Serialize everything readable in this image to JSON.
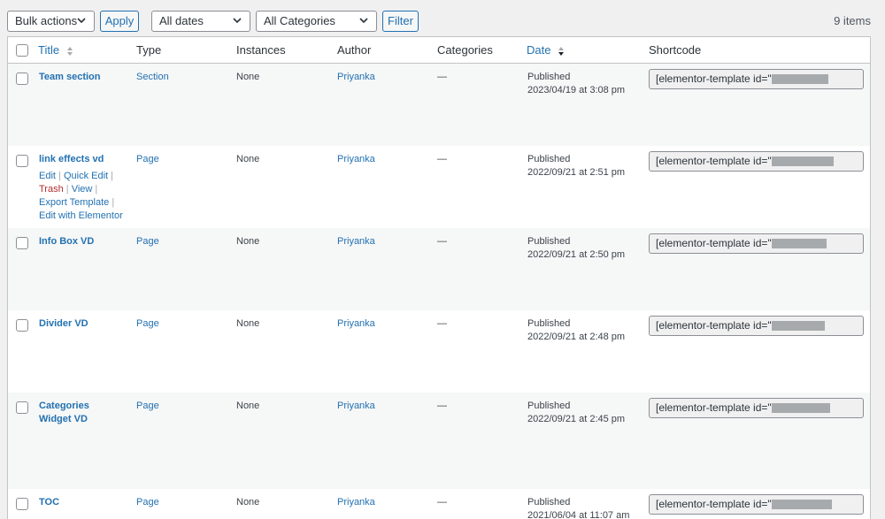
{
  "toolbar": {
    "bulk_actions": "Bulk actions",
    "apply": "Apply",
    "dates": "All dates",
    "categories": "All Categories",
    "filter": "Filter",
    "items_count": "9 items"
  },
  "table": {
    "headers": {
      "title": "Title",
      "type": "Type",
      "instances": "Instances",
      "author": "Author",
      "categories": "Categories",
      "date": "Date",
      "shortcode": "Shortcode"
    },
    "rows": [
      {
        "title": "Team section",
        "type": "Section",
        "instances": "None",
        "author": "Priyanka",
        "categories": "—",
        "status": "Published",
        "date": "2023/04/19 at 3:08 pm",
        "shortcode": "[elementor-template id=\""
      },
      {
        "title": "link effects vd",
        "type": "Page",
        "instances": "None",
        "author": "Priyanka",
        "categories": "—",
        "status": "Published",
        "date": "2022/09/21 at 2:51 pm",
        "shortcode": "[elementor-template id=\"",
        "actions": {
          "edit": "Edit",
          "quick_edit": "Quick Edit",
          "trash": "Trash",
          "view": "View",
          "export": "Export Template",
          "elementor": "Edit with Elementor",
          "sep": "|"
        }
      },
      {
        "title": "Info Box VD",
        "type": "Page",
        "instances": "None",
        "author": "Priyanka",
        "categories": "—",
        "status": "Published",
        "date": "2022/09/21 at 2:50 pm",
        "shortcode": "[elementor-template id=\""
      },
      {
        "title": "Divider VD",
        "type": "Page",
        "instances": "None",
        "author": "Priyanka",
        "categories": "—",
        "status": "Published",
        "date": "2022/09/21 at 2:48 pm",
        "shortcode": "[elementor-template id=\""
      },
      {
        "title": "Categories Widget VD",
        "type": "Page",
        "instances": "None",
        "author": "Priyanka",
        "categories": "—",
        "status": "Published",
        "date": "2022/09/21 at 2:45 pm",
        "shortcode": "[elementor-template id=\""
      },
      {
        "title": "TOC",
        "type": "Page",
        "instances": "None",
        "author": "Priyanka",
        "categories": "—",
        "status": "Published",
        "date": "2021/06/04 at 11:07 am",
        "shortcode": "[elementor-template id=\""
      }
    ]
  },
  "colors": {
    "link": "#2271b1",
    "trash": "#b32d2e",
    "border": "#c3c4c7",
    "alt_row": "#f6f7f7"
  }
}
